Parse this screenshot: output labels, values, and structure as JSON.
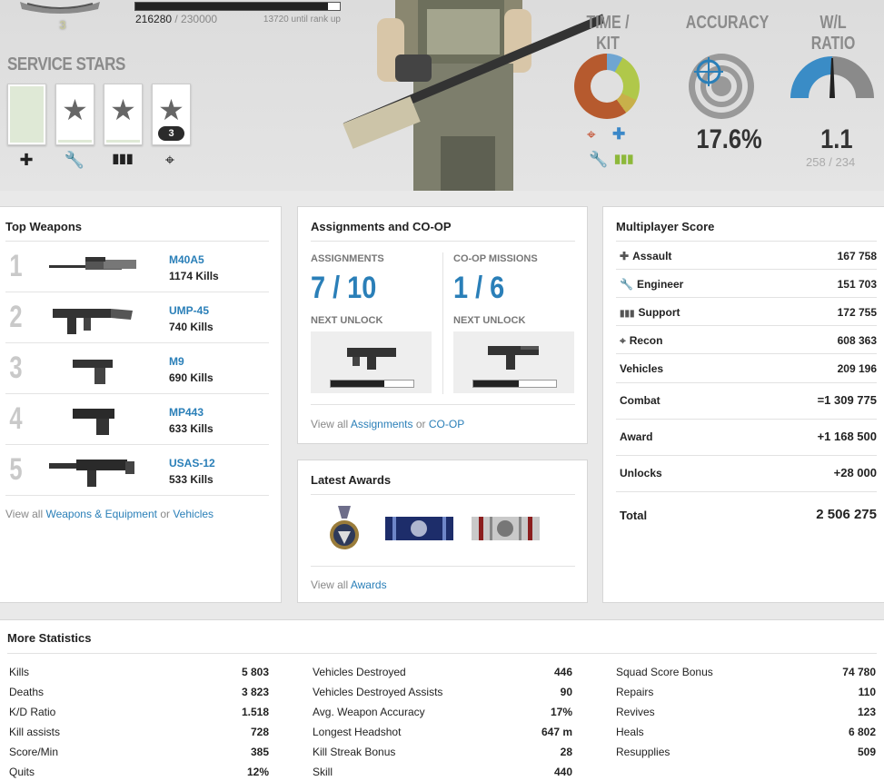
{
  "header": {
    "rank_number": "3",
    "xp_current": "216280",
    "xp_total": " / 230000",
    "xp_progress": 0.94,
    "until_rank_up": "13720 until rank up",
    "service_stars_title": "SERVICE STARS",
    "service_star_count": "3",
    "time_kit_title": "TIME / KIT",
    "accuracy_title": "ACCURACY",
    "accuracy_value": "17.6%",
    "wl_title": "W/L RATIO",
    "wl_value": "1.1",
    "wl_sub": "258 / 234"
  },
  "top_weapons": {
    "title": "Top Weapons",
    "items": [
      {
        "rank": "1",
        "name": "M40A5",
        "kills": "1174 Kills"
      },
      {
        "rank": "2",
        "name": "UMP-45",
        "kills": "740 Kills"
      },
      {
        "rank": "3",
        "name": "M9",
        "kills": "690 Kills"
      },
      {
        "rank": "4",
        "name": "MP443",
        "kills": "633 Kills"
      },
      {
        "rank": "5",
        "name": "USAS-12",
        "kills": "533 Kills"
      }
    ],
    "footer_prefix": "View all ",
    "footer_link1": "Weapons & Equipment",
    "footer_or": " or ",
    "footer_link2": "Vehicles"
  },
  "assignments": {
    "title": "Assignments and CO-OP",
    "assign_label": "ASSIGNMENTS",
    "assign_value": "7 / 10",
    "coop_label": "CO-OP MISSIONS",
    "coop_value": "1 / 6",
    "next_unlock_label": "NEXT UNLOCK",
    "assign_progress": 0.65,
    "coop_progress": 0.55,
    "footer_prefix": "View all ",
    "footer_link1": "Assignments",
    "footer_or": " or ",
    "footer_link2": "CO-OP"
  },
  "awards": {
    "title": "Latest Awards",
    "footer_prefix": "View all ",
    "footer_link": "Awards"
  },
  "multiplayer": {
    "title": "Multiplayer Score",
    "rows": [
      {
        "label": "Assault",
        "value": "167 758"
      },
      {
        "label": "Engineer",
        "value": "151 703"
      },
      {
        "label": "Support",
        "value": "172 755"
      },
      {
        "label": "Recon",
        "value": "608 363"
      },
      {
        "label": "Vehicles",
        "value": "209 196"
      },
      {
        "label": "Combat",
        "value": "=1 309 775"
      },
      {
        "label": "Award",
        "value": "+1 168 500"
      },
      {
        "label": "Unlocks",
        "value": "+28 000"
      },
      {
        "label": "Total",
        "value": "2 506 275"
      }
    ]
  },
  "more_stats": {
    "title": "More Statistics",
    "col1": [
      {
        "label": "Kills",
        "value": "5 803"
      },
      {
        "label": "Deaths",
        "value": "3 823"
      },
      {
        "label": "K/D Ratio",
        "value": "1.518"
      },
      {
        "label": "Kill assists",
        "value": "728"
      },
      {
        "label": "Score/Min",
        "value": "385"
      },
      {
        "label": "Quits",
        "value": "12%"
      }
    ],
    "col2": [
      {
        "label": "Vehicles Destroyed",
        "value": "446"
      },
      {
        "label": "Vehicles Destroyed Assists",
        "value": "90"
      },
      {
        "label": "Avg. Weapon Accuracy",
        "value": "17%"
      },
      {
        "label": "Longest Headshot",
        "value": "647 m"
      },
      {
        "label": "Kill Streak Bonus",
        "value": "28"
      },
      {
        "label": "Skill",
        "value": "440"
      }
    ],
    "col3": [
      {
        "label": "Squad Score Bonus",
        "value": "74 780"
      },
      {
        "label": "Repairs",
        "value": "110"
      },
      {
        "label": "Revives",
        "value": "123"
      },
      {
        "label": "Heals",
        "value": "6 802"
      },
      {
        "label": "Resupplies",
        "value": "509"
      }
    ]
  }
}
